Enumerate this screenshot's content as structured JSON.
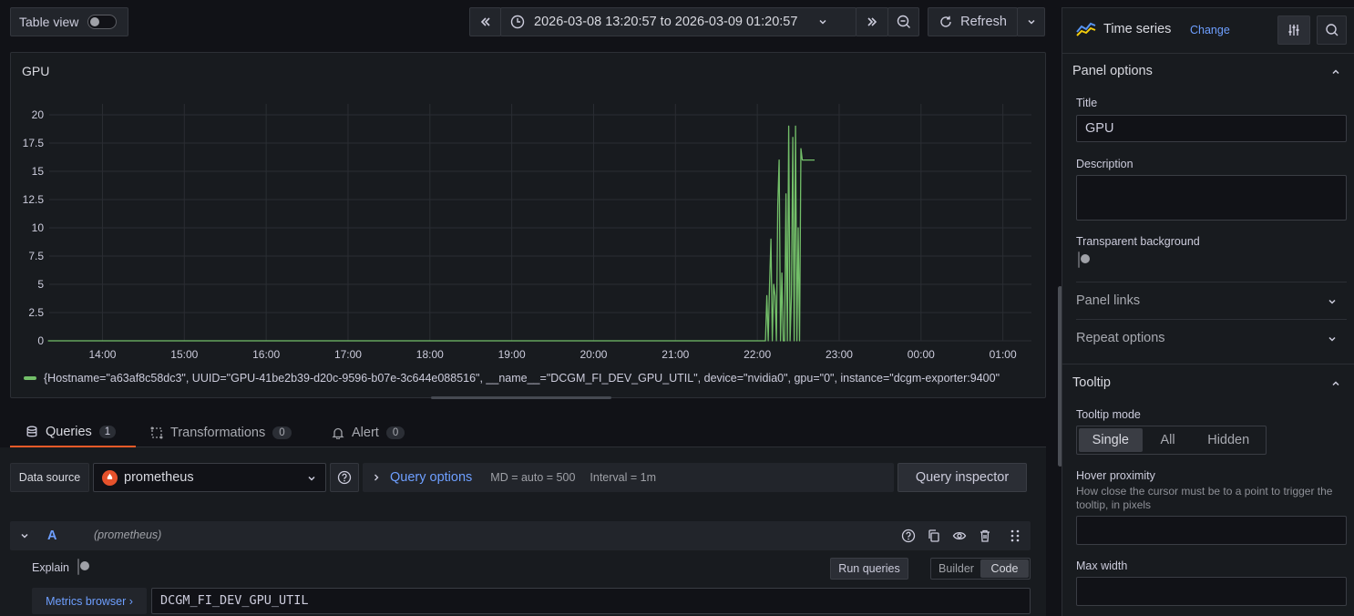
{
  "toolbar": {
    "table_view_label": "Table view",
    "time_range": "2026-03-08 13:20:57 to 2026-03-09 01:20:57",
    "refresh_label": "Refresh"
  },
  "panel": {
    "title": "GPU",
    "legend": "{Hostname=\"a63af8c58dc3\", UUID=\"GPU-41be2b39-d20c-9596-b07e-3c644e088516\", __name__=\"DCGM_FI_DEV_GPU_UTIL\", device=\"nvidia0\", gpu=\"0\", instance=\"dcgm-exporter:9400\"",
    "series_color": "#73bf69"
  },
  "chart_data": {
    "type": "line",
    "x_ticks": [
      "14:00",
      "15:00",
      "16:00",
      "17:00",
      "18:00",
      "19:00",
      "20:00",
      "21:00",
      "22:00",
      "23:00",
      "00:00",
      "01:00"
    ],
    "y_ticks": [
      "20",
      "17.5",
      "15",
      "12.5",
      "10",
      "7.5",
      "5",
      "2.5",
      "0"
    ],
    "ylim": [
      0,
      20
    ],
    "x_start": "13:20:57",
    "x_end": "01:20:57",
    "series": [
      {
        "x": [
          "13:20",
          "22:06",
          "22:07",
          "22:08",
          "22:09",
          "22:10",
          "22:11",
          "22:12",
          "22:13",
          "22:14",
          "22:15",
          "22:16",
          "22:17",
          "22:18",
          "22:19",
          "22:20",
          "22:21",
          "22:22",
          "22:23",
          "22:24",
          "22:25",
          "22:26",
          "22:27",
          "22:28",
          "22:29",
          "22:30",
          "22:31",
          "22:32",
          "22:33",
          "22:34",
          "22:35",
          "22:36",
          "22:37",
          "22:38",
          "22:39",
          "22:40",
          "22:41",
          "22:42"
        ],
        "values": [
          0,
          0,
          4,
          0,
          5,
          9,
          0,
          5,
          4,
          0,
          12,
          16,
          0,
          6,
          0,
          0,
          13,
          0,
          19,
          0,
          4,
          18,
          0,
          19,
          0,
          10,
          0,
          17,
          16,
          16,
          16,
          16,
          16,
          16,
          16,
          16,
          16,
          16
        ]
      }
    ]
  },
  "tabs": {
    "queries": "Queries",
    "queries_count": "1",
    "transformations": "Transformations",
    "transformations_count": "0",
    "alert": "Alert",
    "alert_count": "0"
  },
  "query_bar": {
    "data_source_label": "Data source",
    "data_source": "prometheus",
    "query_options": "Query options",
    "md": "MD = auto = 500",
    "interval": "Interval = 1m",
    "inspector": "Query inspector"
  },
  "query_row": {
    "ref": "A",
    "ds": "(prometheus)",
    "explain": "Explain",
    "run": "Run queries",
    "builder": "Builder",
    "code": "Code",
    "metrics_browser": "Metrics browser ›",
    "query": "DCGM_FI_DEV_GPU_UTIL"
  },
  "options": {
    "viz_name": "Time series",
    "change": "Change",
    "panel_options": "Panel options",
    "title_label": "Title",
    "title_value": "GPU",
    "description_label": "Description",
    "transparent_label": "Transparent background",
    "panel_links": "Panel links",
    "repeat_options": "Repeat options",
    "tooltip": "Tooltip",
    "tooltip_mode_label": "Tooltip mode",
    "modes": [
      "Single",
      "All",
      "Hidden"
    ],
    "hover_label": "Hover proximity",
    "hover_desc": "How close the cursor must be to a point to trigger the tooltip, in pixels",
    "max_width_label": "Max width"
  }
}
